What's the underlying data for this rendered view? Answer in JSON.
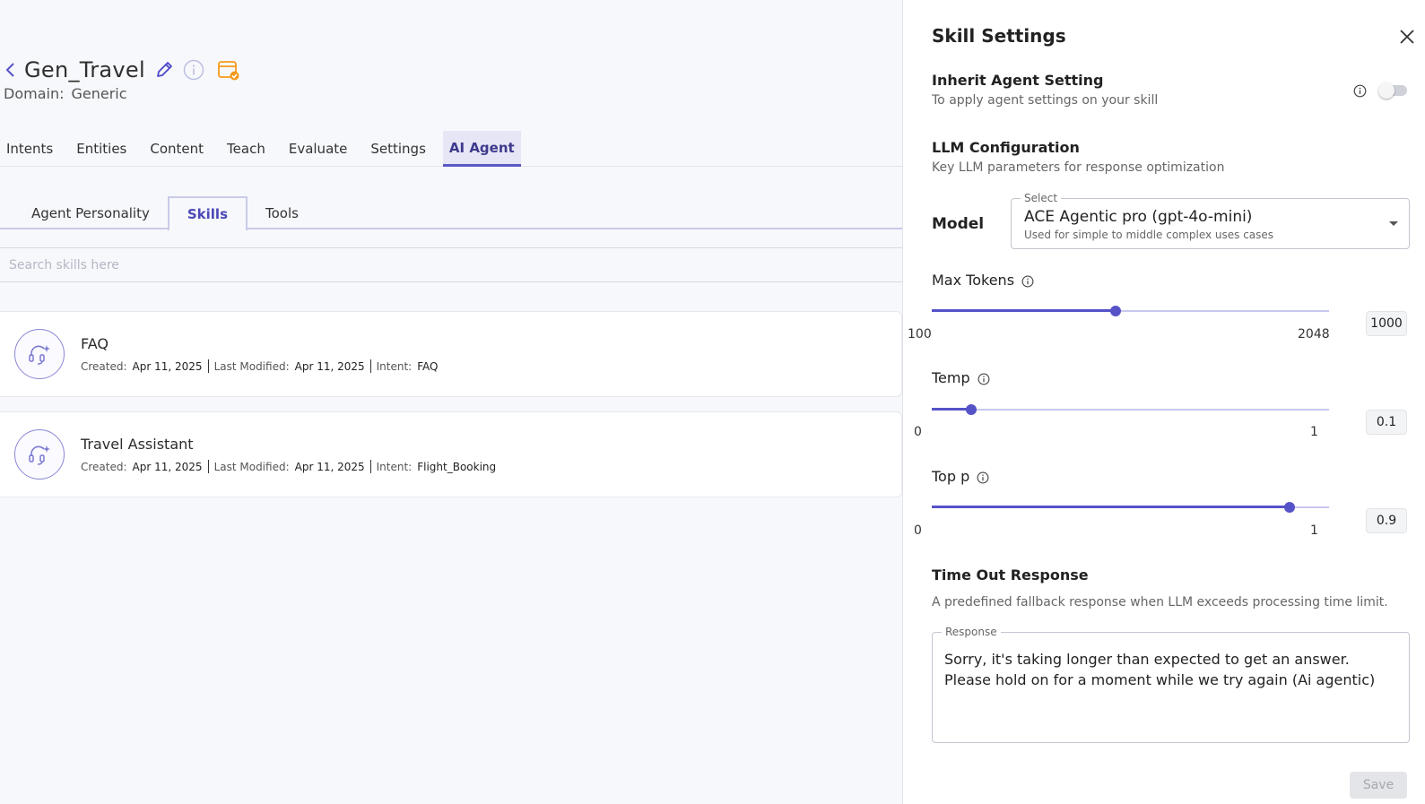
{
  "header": {
    "bot_name": "Gen_Travel",
    "domain_label": "Domain:",
    "domain_value": "Generic"
  },
  "top_tabs": [
    {
      "label": "Intents"
    },
    {
      "label": "Entities"
    },
    {
      "label": "Content"
    },
    {
      "label": "Teach"
    },
    {
      "label": "Evaluate"
    },
    {
      "label": "Settings"
    },
    {
      "label": "AI Agent",
      "active": true
    }
  ],
  "sub_tabs": [
    {
      "label": "Agent Personality"
    },
    {
      "label": "Skills",
      "active": true
    },
    {
      "label": "Tools"
    }
  ],
  "search": {
    "placeholder": "Search skills here",
    "value": ""
  },
  "skills": [
    {
      "name": "FAQ",
      "created_label": "Created:",
      "created": "Apr 11, 2025",
      "modified_label": "Last Modified:",
      "modified": "Apr 11, 2025",
      "intent_label": "Intent:",
      "intent": "FAQ"
    },
    {
      "name": "Travel Assistant",
      "created_label": "Created:",
      "created": "Apr 11, 2025",
      "modified_label": "Last Modified:",
      "modified": "Apr 11, 2025",
      "intent_label": "Intent:",
      "intent": "Flight_Booking"
    }
  ],
  "panel": {
    "title": "Skill Settings",
    "inherit": {
      "title": "Inherit Agent Setting",
      "desc": "To apply agent settings on your skill",
      "enabled": false
    },
    "llm": {
      "title": "LLM Configuration",
      "desc": "Key LLM parameters for response optimization"
    },
    "model": {
      "label": "Model",
      "select_legend": "Select",
      "value": "ACE Agentic pro (gpt-4o-mini)",
      "desc": "Used for simple to middle complex uses cases"
    },
    "params": [
      {
        "label": "Max Tokens",
        "min": 100,
        "max": 2048,
        "value": 1000,
        "min_label": "100",
        "max_label": "2048",
        "value_label": "1000"
      },
      {
        "label": "Temp",
        "min": 0,
        "max": 1,
        "value": 0.1,
        "min_label": "0",
        "max_label": "1",
        "value_label": "0.1"
      },
      {
        "label": "Top p",
        "min": 0,
        "max": 1,
        "value": 0.9,
        "min_label": "0",
        "max_label": "1",
        "value_label": "0.9"
      }
    ],
    "timeout": {
      "title": "Time Out Response",
      "desc": "A predefined fallback response when LLM exceeds processing time limit.",
      "legend": "Response",
      "value": "Sorry, it's taking longer than expected to get an answer. Please hold on for a moment while we try again (Ai agentic)"
    },
    "save_label": "Save"
  },
  "colors": {
    "accent": "#5653c9",
    "calendar_icon": "#f59a1b",
    "pencil_icon": "#4b47c9"
  }
}
